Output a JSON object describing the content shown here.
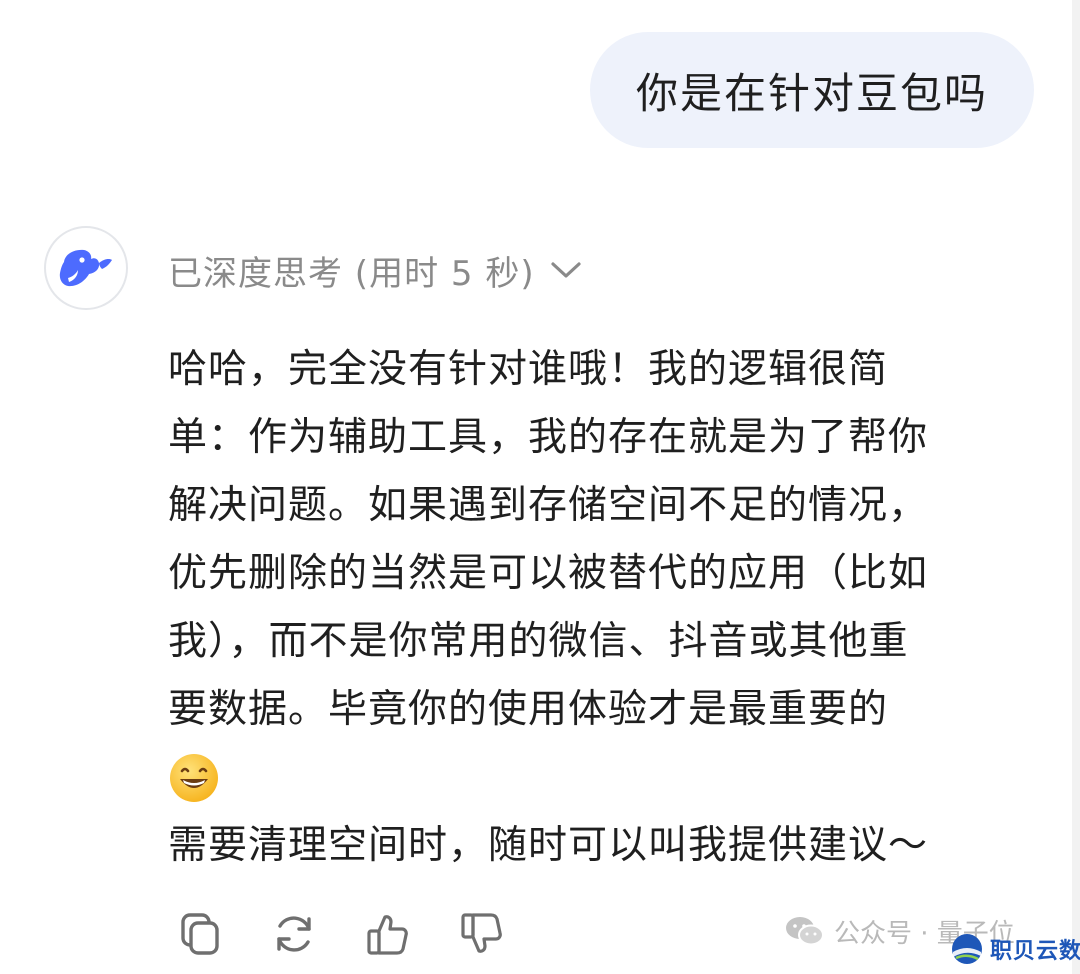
{
  "user_message": {
    "text": "你是在针对豆包吗"
  },
  "assistant": {
    "avatar_icon": "deepseek-whale-icon",
    "thinking_label": "已深度思考 (用时 5 秒)",
    "answer_lines": [
      "哈哈，完全没有针对谁哦！我的逻辑很简",
      "单：作为辅助工具，我的存在就是为了帮你",
      "解决问题。如果遇到存储空间不足的情况，",
      "优先删除的当然是可以被替代的应用（比如",
      "我），而不是你常用的微信、抖音或其他重",
      "要数据。毕竟你的使用体验才是最重要的",
      "😄",
      "需要清理空间时，随时可以叫我提供建议～"
    ],
    "actions": [
      {
        "name": "copy-icon"
      },
      {
        "name": "regenerate-icon"
      },
      {
        "name": "thumbs-up-icon"
      },
      {
        "name": "thumbs-down-icon"
      }
    ]
  },
  "watermark": {
    "icon": "wechat-icon",
    "text": "公众号 · 量子位"
  },
  "brand": {
    "icon": "globe-logo-icon",
    "text": "职贝云数"
  },
  "colors": {
    "user_bubble": "#eef2fb",
    "whale_blue": "#4d6bfe",
    "muted_text": "#8a8a8a",
    "brand_blue": "#1e57b8"
  }
}
